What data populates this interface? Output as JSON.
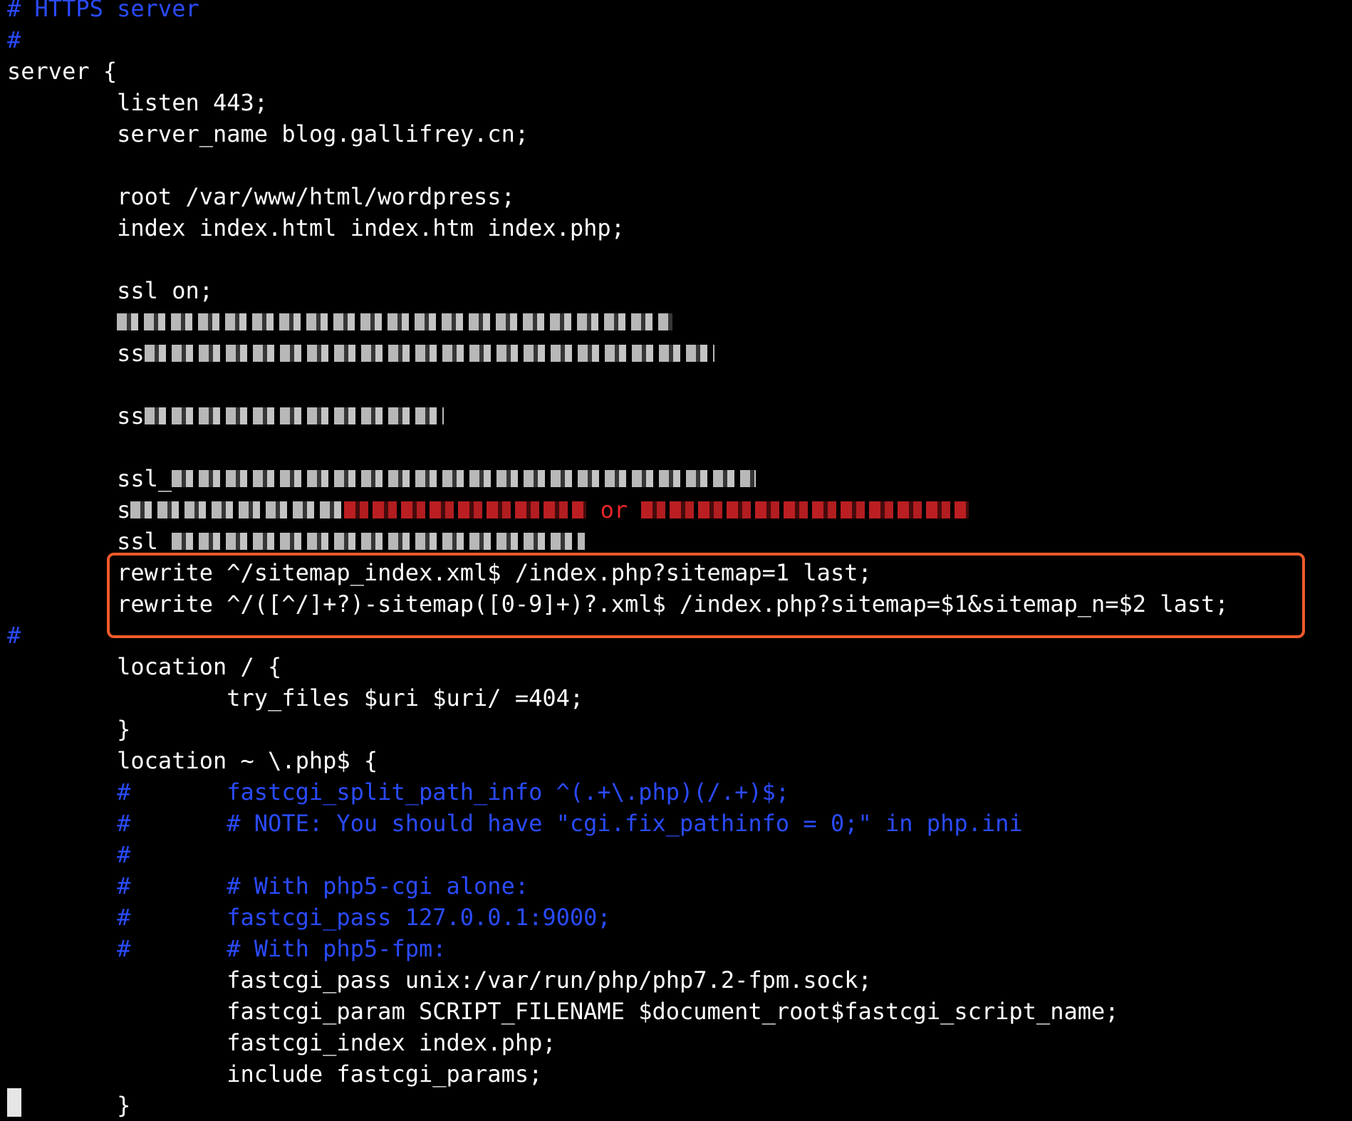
{
  "terminal": {
    "lines": [
      {
        "segments": [
          {
            "text": "# HTTPS server",
            "color": "comment"
          }
        ]
      },
      {
        "segments": [
          {
            "text": "#",
            "color": "comment"
          }
        ]
      },
      {
        "segments": [
          {
            "text": "server {",
            "color": "normal"
          }
        ]
      },
      {
        "segments": [
          {
            "text": "        listen 443;",
            "color": "normal"
          }
        ]
      },
      {
        "segments": [
          {
            "text": "        server_name blog.gallifrey.cn;",
            "color": "normal"
          }
        ]
      },
      {
        "segments": []
      },
      {
        "segments": [
          {
            "text": "        root /var/www/html/wordpress;",
            "color": "normal"
          }
        ]
      },
      {
        "segments": [
          {
            "text": "        index index.html index.htm index.php;",
            "color": "normal"
          }
        ]
      },
      {
        "segments": []
      },
      {
        "segments": [
          {
            "text": "        ssl on;",
            "color": "normal"
          }
        ]
      },
      {
        "segments": [
          {
            "text": "        ",
            "color": "normal"
          },
          {
            "redacted": 780,
            "color": "normal"
          }
        ]
      },
      {
        "segments": [
          {
            "text": "        ss",
            "color": "normal"
          },
          {
            "redacted": 800,
            "color": "normal"
          }
        ]
      },
      {
        "segments": []
      },
      {
        "segments": [
          {
            "text": "        ss",
            "color": "normal"
          },
          {
            "redacted": 420,
            "color": "normal"
          }
        ]
      },
      {
        "segments": []
      },
      {
        "segments": [
          {
            "text": "        ssl_",
            "color": "normal"
          },
          {
            "redacted": 820,
            "color": "normal"
          }
        ]
      },
      {
        "segments": [
          {
            "text": "        s",
            "color": "normal"
          },
          {
            "redacted": 300,
            "color": "normal"
          },
          {
            "redacted": 340,
            "color": "red"
          },
          {
            "text": " or ",
            "color": "red"
          },
          {
            "redacted": 460,
            "color": "red"
          }
        ]
      },
      {
        "segments": [
          {
            "text": "        ssl_",
            "color": "normal"
          },
          {
            "redacted": 580,
            "color": "normal"
          }
        ]
      },
      {
        "segments": [
          {
            "text": "        rewrite ^/sitemap_index.xml$ /index.php?sitemap=1 last;",
            "color": "normal"
          }
        ]
      },
      {
        "segments": [
          {
            "text": "        rewrite ^/([^/]+?)-sitemap([0-9]+)?.xml$ /index.php?sitemap=$1&sitemap_n=$2 last;",
            "color": "normal"
          }
        ]
      },
      {
        "segments": [
          {
            "text": "#",
            "color": "comment"
          }
        ]
      },
      {
        "segments": [
          {
            "text": "        location / {",
            "color": "normal"
          }
        ]
      },
      {
        "segments": [
          {
            "text": "                try_files $uri $uri/ =404;",
            "color": "normal"
          }
        ]
      },
      {
        "segments": [
          {
            "text": "        }",
            "color": "normal"
          }
        ]
      },
      {
        "segments": [
          {
            "text": "        location ~ \\.php$ {",
            "color": "normal"
          }
        ]
      },
      {
        "segments": [
          {
            "text": "        #       fastcgi_split_path_info ^(.+\\.php)(/.+)$;",
            "color": "comment"
          }
        ]
      },
      {
        "segments": [
          {
            "text": "        #       # NOTE: You should have \"cgi.fix_pathinfo = 0;\" in php.ini",
            "color": "comment"
          }
        ]
      },
      {
        "segments": [
          {
            "text": "        #",
            "color": "comment"
          }
        ]
      },
      {
        "segments": [
          {
            "text": "        #       # With php5-cgi alone:",
            "color": "comment"
          }
        ]
      },
      {
        "segments": [
          {
            "text": "        #       fastcgi_pass 127.0.0.1:9000;",
            "color": "comment"
          }
        ]
      },
      {
        "segments": [
          {
            "text": "        #       # With php5-fpm:",
            "color": "comment"
          }
        ]
      },
      {
        "segments": [
          {
            "text": "                fastcgi_pass unix:/var/run/php/php7.2-fpm.sock;",
            "color": "normal"
          }
        ]
      },
      {
        "segments": [
          {
            "text": "                fastcgi_param SCRIPT_FILENAME $document_root$fastcgi_script_name;",
            "color": "normal"
          }
        ]
      },
      {
        "segments": [
          {
            "text": "                fastcgi_index index.php;",
            "color": "normal"
          }
        ]
      },
      {
        "segments": [
          {
            "text": "                include fastcgi_params;",
            "color": "normal"
          }
        ]
      },
      {
        "segments": [
          {
            "text": "        }",
            "color": "normal"
          }
        ]
      }
    ]
  },
  "colors": {
    "background": "#000000",
    "normal": "#ffffff",
    "comment": "#2a4bff",
    "red": "#e8262a",
    "highlight_border": "#f05a2a"
  }
}
